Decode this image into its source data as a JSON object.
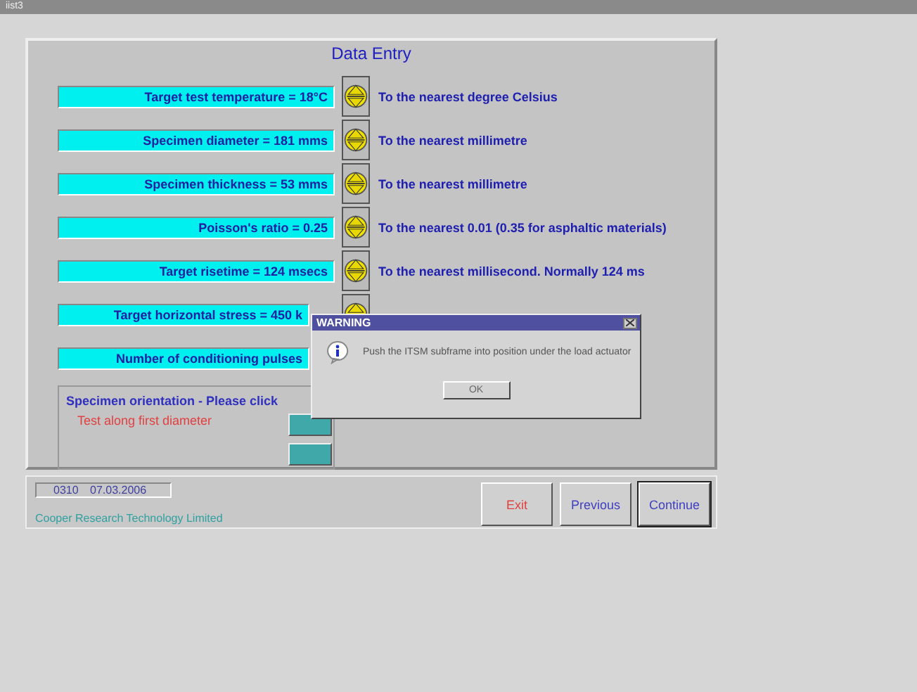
{
  "window": {
    "title": "iist3"
  },
  "panel": {
    "title": "Data Entry",
    "rows": [
      {
        "label": "Target test temperature = 18°C",
        "stepper": true,
        "hint": "To the nearest degree Celsius"
      },
      {
        "label": "Specimen diameter = 181 mms",
        "stepper": true,
        "hint": "To the nearest millimetre"
      },
      {
        "label": "Specimen thickness = 53 mms",
        "stepper": true,
        "hint": "To the nearest millimetre"
      },
      {
        "label": "Poisson's ratio = 0.25",
        "stepper": true,
        "hint": "To the nearest 0.01 (0.35 for asphaltic materials)"
      },
      {
        "label": "Target risetime = 124 msecs",
        "stepper": true,
        "hint": "To the nearest millisecond. Normally 124 ms"
      },
      {
        "label": "Target horizontal stress = 450 k",
        "stepper": true
      },
      {
        "label": "Number of conditioning pulses",
        "stepper": false
      }
    ],
    "orientation": {
      "title": "Specimen orientation - Please click",
      "option": "Test along first diameter"
    }
  },
  "status": {
    "time": "0310",
    "date": "07.03.2006",
    "company": "Cooper Research Technology Limited"
  },
  "buttons": [
    {
      "label": "Exit",
      "kind": "exit"
    },
    {
      "label": "Previous",
      "kind": "nav"
    },
    {
      "label": "Continue",
      "kind": "default"
    }
  ],
  "dialog": {
    "title": "WARNING",
    "message": "Push the ITSM subframe into position under the load actuator",
    "button": "OK"
  }
}
